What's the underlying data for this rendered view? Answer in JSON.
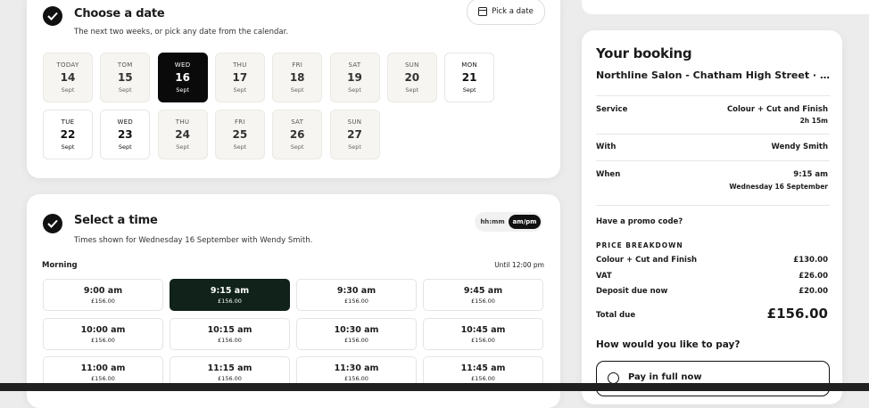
{
  "date_section": {
    "title": "Choose a date",
    "subtitle": "The next two weeks, or pick any date from the calendar.",
    "pick_button": "Pick a date",
    "days": [
      {
        "dow": "TODAY",
        "num": "14",
        "month": "Sept",
        "state": "unavailable"
      },
      {
        "dow": "TOM",
        "num": "15",
        "month": "Sept",
        "state": "unavailable"
      },
      {
        "dow": "WED",
        "num": "16",
        "month": "Sept",
        "state": "selected"
      },
      {
        "dow": "THU",
        "num": "17",
        "month": "Sept",
        "state": "unavailable"
      },
      {
        "dow": "FRI",
        "num": "18",
        "month": "Sept",
        "state": "unavailable"
      },
      {
        "dow": "SAT",
        "num": "19",
        "month": "Sept",
        "state": "unavailable"
      },
      {
        "dow": "SUN",
        "num": "20",
        "month": "Sept",
        "state": "unavailable"
      },
      {
        "dow": "MON",
        "num": "21",
        "month": "Sept",
        "state": "available"
      },
      {
        "dow": "TUE",
        "num": "22",
        "month": "Sept",
        "state": "available"
      },
      {
        "dow": "WED",
        "num": "23",
        "month": "Sept",
        "state": "available"
      },
      {
        "dow": "THU",
        "num": "24",
        "month": "Sept",
        "state": "unavailable"
      },
      {
        "dow": "FRI",
        "num": "25",
        "month": "Sept",
        "state": "unavailable"
      },
      {
        "dow": "SAT",
        "num": "26",
        "month": "Sept",
        "state": "unavailable"
      },
      {
        "dow": "SUN",
        "num": "27",
        "month": "Sept",
        "state": "unavailable"
      }
    ]
  },
  "time_section": {
    "title": "Select a time",
    "subtitle": "Times shown for Wednesday 16 September with Wendy Smith.",
    "format_24h": "hh:mm",
    "format_12h": "am/pm",
    "group_label": "Morning",
    "group_until": "Until 12:00 pm",
    "slots": [
      {
        "time": "9:00 am",
        "price": "£156.00",
        "selected": false
      },
      {
        "time": "9:15 am",
        "price": "£156.00",
        "selected": true
      },
      {
        "time": "9:30 am",
        "price": "£156.00",
        "selected": false
      },
      {
        "time": "9:45 am",
        "price": "£156.00",
        "selected": false
      },
      {
        "time": "10:00 am",
        "price": "£156.00",
        "selected": false
      },
      {
        "time": "10:15 am",
        "price": "£156.00",
        "selected": false
      },
      {
        "time": "10:30 am",
        "price": "£156.00",
        "selected": false
      },
      {
        "time": "10:45 am",
        "price": "£156.00",
        "selected": false
      },
      {
        "time": "11:00 am",
        "price": "£156.00",
        "selected": false
      },
      {
        "time": "11:15 am",
        "price": "£156.00",
        "selected": false
      },
      {
        "time": "11:30 am",
        "price": "£156.00",
        "selected": false
      },
      {
        "time": "11:45 am",
        "price": "£156.00",
        "selected": false
      }
    ]
  },
  "booking": {
    "title": "Your booking",
    "venue": "Northline Salon - Chatham High Street · Chatham",
    "service_label": "Service",
    "service_name": "Colour + Cut and Finish",
    "service_duration": "2h 15m",
    "with_label": "With",
    "with_value": "Wendy Smith",
    "when_label": "When",
    "when_time": "9:15 am",
    "when_date": "Wednesday 16 September",
    "promo_label": "Have a promo code?",
    "price_heading": "PRICE BREAKDOWN",
    "lines": [
      {
        "label": "Colour + Cut and Finish",
        "value": "£130.00"
      },
      {
        "label": "VAT",
        "value": "£26.00"
      },
      {
        "label": "Deposit due now",
        "value": "£20.00"
      }
    ],
    "total_label": "Total due",
    "total_value": "£156.00",
    "pay_question": "How would you like to pay?",
    "pay_option": "Pay in full now"
  }
}
